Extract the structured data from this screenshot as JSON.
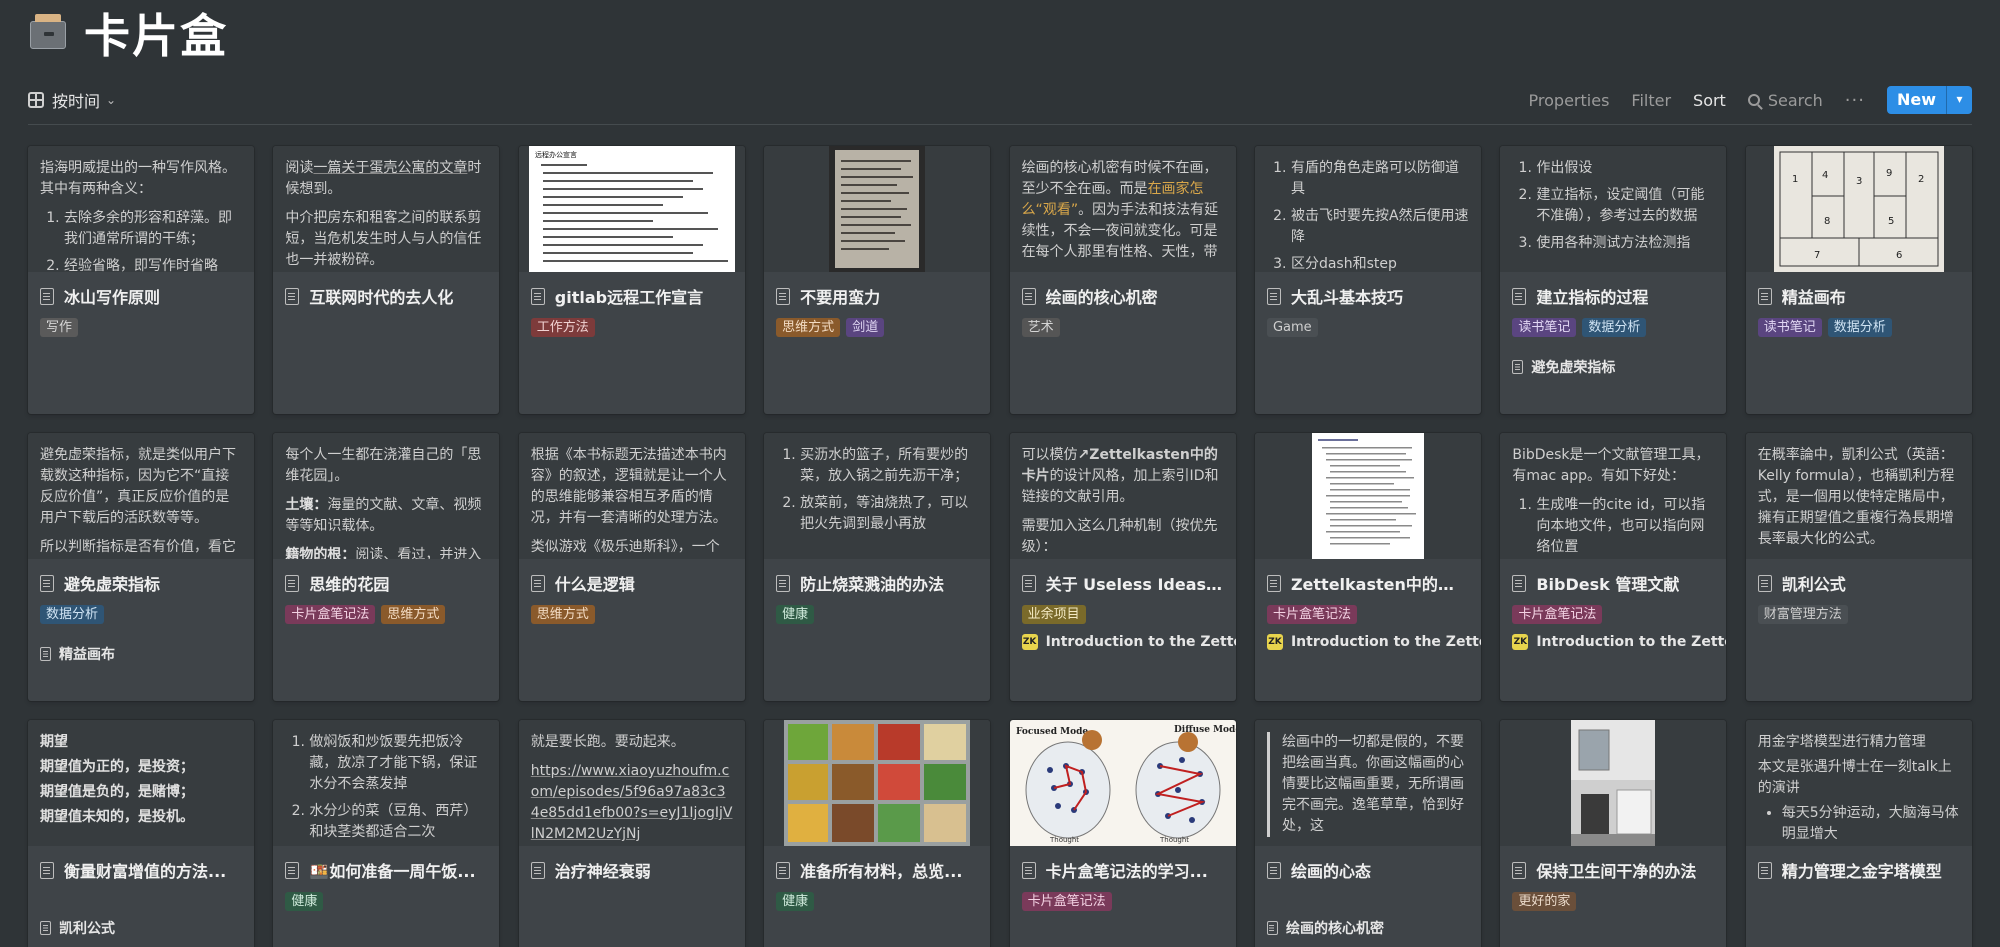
{
  "title": "卡片盒",
  "toolbar": {
    "view_label": "按时间",
    "properties": "Properties",
    "filter": "Filter",
    "sort": "Sort",
    "search": "Search",
    "more": "···",
    "new": "New"
  },
  "tag_colors": {
    "写作": [
      "#5a5a5a",
      "#d6d6d6"
    ],
    "工作方法": [
      "#7d3b3b",
      "#f0d2d2"
    ],
    "思维方式": [
      "#8a5a2b",
      "#f3dcc4"
    ],
    "剑道": [
      "#5a4580",
      "#e0d6f3"
    ],
    "艺术": [
      "#555555",
      "#d6d6d6"
    ],
    "Game": [
      "#4a4f53",
      "#cfcfcf"
    ],
    "读书笔记": [
      "#5a4580",
      "#e0d6f3"
    ],
    "数据分析": [
      "#2f5575",
      "#cfe3f3"
    ],
    "卡片盒笔记法": [
      "#7a3a5a",
      "#f3d2e3"
    ],
    "健康": [
      "#2f5a45",
      "#cfeadb"
    ],
    "业余项目": [
      "#7a6a2a",
      "#f3e9c4"
    ],
    "财富管理方法": [
      "#4a4f53",
      "#cfcfcf"
    ],
    "更好的家": [
      "#6a4f3a",
      "#ecdccc"
    ]
  },
  "cards": [
    {
      "title": "冰山写作原则",
      "tags": [
        "写作"
      ],
      "preview": {
        "p1": "指海明威提出的一种写作风格。其中有两种含义：",
        "li1": "去除多余的形容和辞藻。即我们通常所谓的干练；",
        "li2": "经验省略，即写作时省略"
      }
    },
    {
      "title": "互联网时代的去人化",
      "tags": [],
      "preview": {
        "p1a": "阅读",
        "link": "一篇关于蛋壳公寓的文章",
        "p1b": "时候想到。",
        "p2": "中介把房东和租客之间的联系剪短，当危机发生时人与人的信任也一并被粉碎。"
      }
    },
    {
      "title": "gitlab远程工作宣言",
      "tags": [
        "工作方法"
      ],
      "image": "doc",
      "doc_heading": "远程办公宣言"
    },
    {
      "title": "不要用蛮力",
      "tags": [
        "思维方式",
        "剑道"
      ],
      "image": "photo-paper"
    },
    {
      "title": "绘画的核心机密",
      "tags": [
        "艺术"
      ],
      "preview": {
        "p1a": "绘画的核心机密有时候不在画，至少不全在画。而是",
        "hl": "在画家怎么“观看”",
        "p1b": "。因为手法和技法有延续性，不会一夜间就变化。可是在每个人那里有性格、天性，带"
      }
    },
    {
      "title": "大乱斗基本技巧",
      "tags": [
        "Game"
      ],
      "preview": {
        "li1": "有盾的角色走路可以防御道具",
        "li2": "被击飞时要先按A然后便用速降",
        "li3": "区分dash和step"
      }
    },
    {
      "title": "建立指标的过程",
      "tags": [
        "读书笔记",
        "数据分析"
      ],
      "related": "避免虚荣指标",
      "preview": {
        "li1": "作出假设",
        "li2": "建立指标，设定阈值（可能不准确），参考过去的数据",
        "li3": "使用各种测试方法检测指"
      }
    },
    {
      "title": "精益画布",
      "tags": [
        "读书笔记",
        "数据分析"
      ],
      "image": "canvas"
    },
    {
      "title": "避免虚荣指标",
      "tags": [
        "数据分析"
      ],
      "related": "精益画布",
      "preview": {
        "p1": "避免虚荣指标，就是类似用户下载数这种指标，因为它不“直接反应价值”，真正反应价值的是用户下载后的活跃数等等。",
        "p2": "所以判断指标是否有价值，看它"
      }
    },
    {
      "title": "思维的花园",
      "tags": [
        "卡片盒笔记法",
        "思维方式"
      ],
      "preview": {
        "p1": "每个人一生都在浇灌自己的「思维花园」。",
        "b1": "土壤：",
        "p2": "海量的文献、文章、视频等等知识载体。",
        "b2": "籍物的根：",
        "p3": "阅读、看过，并进入"
      }
    },
    {
      "title": "什么是逻辑",
      "tags": [
        "思维方式"
      ],
      "preview": {
        "p1": "根据《本书标题无法描述本书内容》的叙述，逻辑就是让一个人的思维能够兼容相互矛盾的情况，并有一套清晰的处理方法。",
        "p2": "类似游戏《极乐迪斯科》，一个"
      }
    },
    {
      "title": "防止烧菜溅油的办法",
      "tags": [
        "健康"
      ],
      "preview": {
        "li1": "买沥水的篮子，所有要炒的菜，放入锅之前先沥干净；",
        "li2": "放菜前，等油烧热了，可以把火先调到最小再放"
      }
    },
    {
      "title": "关于 Useless Ideas ...",
      "tags": [
        "业余项目"
      ],
      "zk": "Introduction to the Zettelkasten Method",
      "zk_label": "ZK",
      "preview": {
        "p1a": "可以模仿",
        "p1link": "↗Zettelkasten中的卡片",
        "p1b": "的设计风格，加上索引ID和链接的文献引用。",
        "p2": "需要加入这么几种机制（按优先级）："
      }
    },
    {
      "title": "Zettelkasten中的索...",
      "tags": [
        "卡片盒笔记法"
      ],
      "zk": "Introduction to the Zettelkasten Method",
      "zk_label": "ZK",
      "image": "index-doc"
    },
    {
      "title": "BibDesk 管理文献",
      "tags": [
        "卡片盒笔记法"
      ],
      "zk": "Introduction to the Zettelkasten Method",
      "zk_label": "ZK",
      "preview": {
        "p1": "BibDesk是一个文献管理工具，有mac app。有如下好处：",
        "li1": "生成唯一的cite id，可以指向本地文件，也可以指向网络位置"
      }
    },
    {
      "title": "凯利公式",
      "tags": [
        "财富管理方法"
      ],
      "preview": {
        "p1": "在概率論中，凱利公式（英語：Kelly formula），也稱凱利方程式，是一個用以使特定賭局中，擁有正期望值之重複行為長期增長率最大化的公式。"
      }
    },
    {
      "title": "衡量财富增值的方法...",
      "tags": [],
      "related": "凯利公式",
      "preview": {
        "h": "期望",
        "b1": "期望值为正的，是投资；",
        "b2": "期望值是负的，是赌博；",
        "b3": "期望值未知的，是投机。"
      }
    },
    {
      "title": "🍱如何准备一周午饭...",
      "tags": [
        "健康"
      ],
      "preview": {
        "li1": "做焖饭和炒饭要先把饭冷藏，放凉了才能下锅，保证水分不会蒸发掉",
        "li2": "水分少的菜（豆角、西芹）和块茎类都适合二次"
      }
    },
    {
      "title": "治疗神经衰弱",
      "tags": [],
      "preview": {
        "p1": "就是要长跑。要动起来。",
        "link": "https://www.xiaoyuzhoufm.com/episodes/5f96a97a83c34e85dd1efb00?s=eyJ1IjogIjVlN2M2M2UzYjNj"
      }
    },
    {
      "title": "准备所有材料，总览...",
      "tags": [
        "健康"
      ],
      "image": "food-tray"
    },
    {
      "title": "卡片盒笔记法的学习...",
      "tags": [
        "卡片盒笔记法"
      ],
      "image": "modes",
      "modes": {
        "left": "Focused Mode",
        "right": "Diffuse Mode",
        "caption": "Thought"
      }
    },
    {
      "title": "绘画的心态",
      "tags": [],
      "related": "绘画的核心机密",
      "preview": {
        "q": "绘画中的一切都是假的，不要把绘画当真。你画这幅画的心情要比这幅画重要，无所谓画完不画完。逸笔草草，恰到好处，这"
      }
    },
    {
      "title": "保持卫生间干净的办法",
      "tags": [
        "更好的家"
      ],
      "image": "bathroom"
    },
    {
      "title": "精力管理之金字塔模型",
      "tags": [],
      "preview": {
        "p1": "用金字塔模型进行精力管理",
        "p2": "本文是张遇升博士在一刻talk上的演讲",
        "li1": "每天5分钟运动，大脑海马体明显增大"
      }
    }
  ]
}
